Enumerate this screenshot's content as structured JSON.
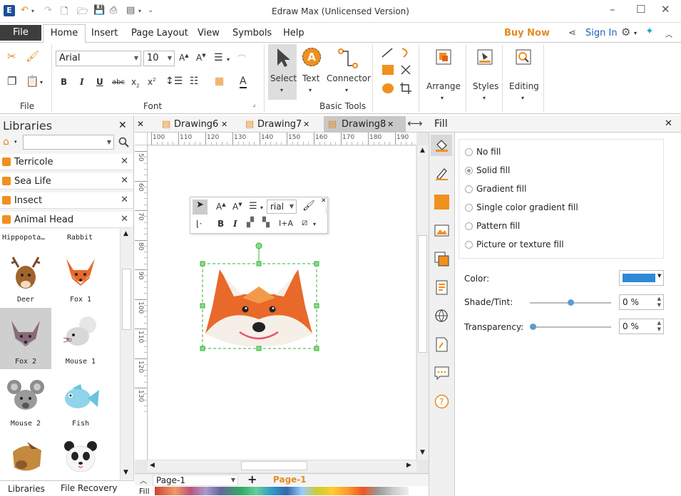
{
  "app": {
    "title": "Edraw Max (Unlicensed Version)"
  },
  "menu": {
    "file": "File",
    "tabs": [
      "Home",
      "Insert",
      "Page Layout",
      "View",
      "Symbols",
      "Help"
    ],
    "buy_now": "Buy Now",
    "sign_in": "Sign In"
  },
  "ribbon": {
    "groups": {
      "file": "File",
      "font": "Font",
      "basic_tools": "Basic Tools"
    },
    "font_name": "Arial",
    "font_size": "10",
    "select_label": "Select",
    "text_label": "Text",
    "connector_label": "Connector",
    "arrange_label": "Arrange",
    "styles_label": "Styles",
    "editing_label": "Editing",
    "text_icon_letter": "A"
  },
  "libraries": {
    "title": "Libraries",
    "search_placeholder": "",
    "categories": [
      "Terricole",
      "Sea Life",
      "Insect",
      "Animal Head"
    ],
    "shapes": [
      "Hippopota…",
      "Rabbit",
      "Deer",
      "Fox 1",
      "Fox 2",
      "Mouse 1",
      "Mouse 2",
      "Fish"
    ],
    "bottom_tabs": [
      "Libraries",
      "File Recovery"
    ]
  },
  "doc_tabs": [
    "Drawing6",
    "Drawing7",
    "Drawing8"
  ],
  "ruler": {
    "h_ticks": [
      "100",
      "110",
      "120",
      "130",
      "140",
      "150",
      "160",
      "170",
      "180",
      "190"
    ],
    "v_ticks": [
      "50",
      "60",
      "70",
      "80",
      "90",
      "100",
      "110",
      "120",
      "130"
    ]
  },
  "float_toolbar": {
    "font": "rial"
  },
  "page_bar": {
    "page_select": "Page-1",
    "active_page": "Page-1",
    "fill_label": "Fill"
  },
  "fill_panel": {
    "title": "Fill",
    "options": [
      "No fill",
      "Solid fill",
      "Gradient fill",
      "Single color gradient fill",
      "Pattern fill",
      "Picture or texture fill"
    ],
    "selected_option": "Solid fill",
    "color_label": "Color:",
    "color_value": "#2d89d8",
    "shade_label": "Shade/Tint:",
    "shade_value": "0 %",
    "shade_level": 0.5,
    "transparency_label": "Transparency:",
    "transparency_value": "0 %",
    "transparency_level": 0.0
  },
  "colors": {
    "accent_orange": "#f0901e",
    "fox_orange": "#e8692a",
    "selection": "#2fb52f"
  }
}
